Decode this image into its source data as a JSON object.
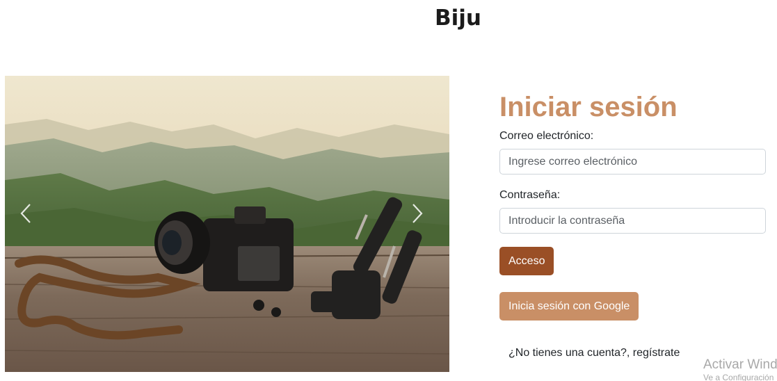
{
  "header": {
    "brand": "Biju"
  },
  "carousel": {
    "prev_icon": "chevron-left-icon",
    "next_icon": "chevron-right-icon"
  },
  "login": {
    "title": "Iniciar sesión",
    "email_label": "Correo electrónico:",
    "email_placeholder": "Ingrese correo electrónico",
    "email_value": "",
    "password_label": "Contraseña:",
    "password_placeholder": "Introducir la contraseña",
    "password_value": "",
    "access_button": "Acceso",
    "google_button": "Inicia sesión con Google",
    "register_link": "¿No tienes una cuenta?, regístrate"
  },
  "colors": {
    "title": "#c98f66",
    "access_button": "#9a4f26",
    "google_button": "#c98f66"
  },
  "watermark": {
    "line1": "Activar Wind",
    "line2": "Ve a Configuración"
  }
}
